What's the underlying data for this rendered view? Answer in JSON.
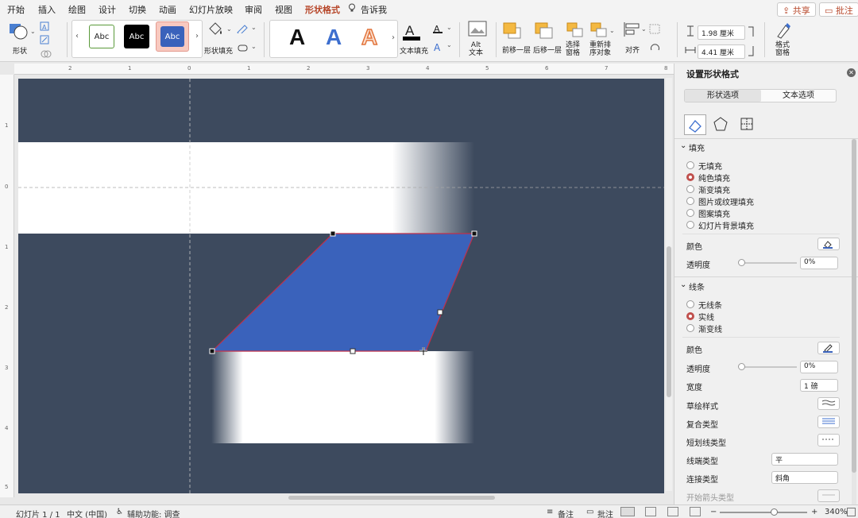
{
  "menu": {
    "tabs": [
      "开始",
      "插入",
      "绘图",
      "设计",
      "切换",
      "动画",
      "幻灯片放映",
      "审阅",
      "视图",
      "形状格式"
    ],
    "active_tab": "形状格式",
    "tell_me": "告诉我",
    "share": "共享",
    "comment": "批注"
  },
  "ribbon": {
    "shape_label": "形状",
    "style_samples": [
      "Abc",
      "Abc",
      "Abc"
    ],
    "shape_fill_label": "形状填充",
    "wordart": [
      "A",
      "A",
      "A"
    ],
    "text_fill_label": "文本填充",
    "alt_text_label": "Alt\n文本",
    "bring_forward": "前移一层",
    "send_backward": "后移一层",
    "selection_pane": "选择\n窗格",
    "reorder": "重新排\n序对象",
    "align": "对齐",
    "height_value": "1.98 厘米",
    "width_value": "4.41 厘米",
    "format_pane": "格式\n窗格"
  },
  "rulers": {
    "top_ticks": [
      "2",
      "1",
      "0",
      "1",
      "2",
      "3",
      "4",
      "5",
      "6",
      "7",
      "8"
    ],
    "left_ticks": [
      "1",
      "0",
      "1",
      "2",
      "3",
      "4",
      "5"
    ]
  },
  "panel": {
    "title": "设置形状格式",
    "tabs": [
      "形状选项",
      "文本选项"
    ],
    "fill_section": "填充",
    "fill_options": [
      "无填充",
      "纯色填充",
      "渐变填充",
      "图片或纹理填充",
      "图案填充",
      "幻灯片背景填充"
    ],
    "fill_selected": "纯色填充",
    "fill_color_label": "颜色",
    "fill_transparency_label": "透明度",
    "fill_transparency_value": "0%",
    "line_section": "线条",
    "line_options": [
      "无线条",
      "实线",
      "渐变线"
    ],
    "line_selected": "实线",
    "line_color_label": "颜色",
    "line_transparency_label": "透明度",
    "line_transparency_value": "0%",
    "width_label": "宽度",
    "width_value": "1 磅",
    "sketch_label": "草绘样式",
    "compound_label": "复合类型",
    "dash_label": "短划线类型",
    "cap_label": "线端类型",
    "cap_value": "平",
    "join_label": "连接类型",
    "join_value": "斜角",
    "arrow_begin_label": "开始箭头类型"
  },
  "status": {
    "slide": "幻灯片 1 / 1",
    "language": "中文 (中国)",
    "accessibility": "辅助功能: 调查",
    "notes": "备注",
    "comments": "批注",
    "zoom": "340%"
  },
  "colors": {
    "accent": "#b7472a",
    "slide_bg": "#3d4a5e",
    "shape_fill": "#3a62bb",
    "shape_outline": "#c0304a"
  }
}
